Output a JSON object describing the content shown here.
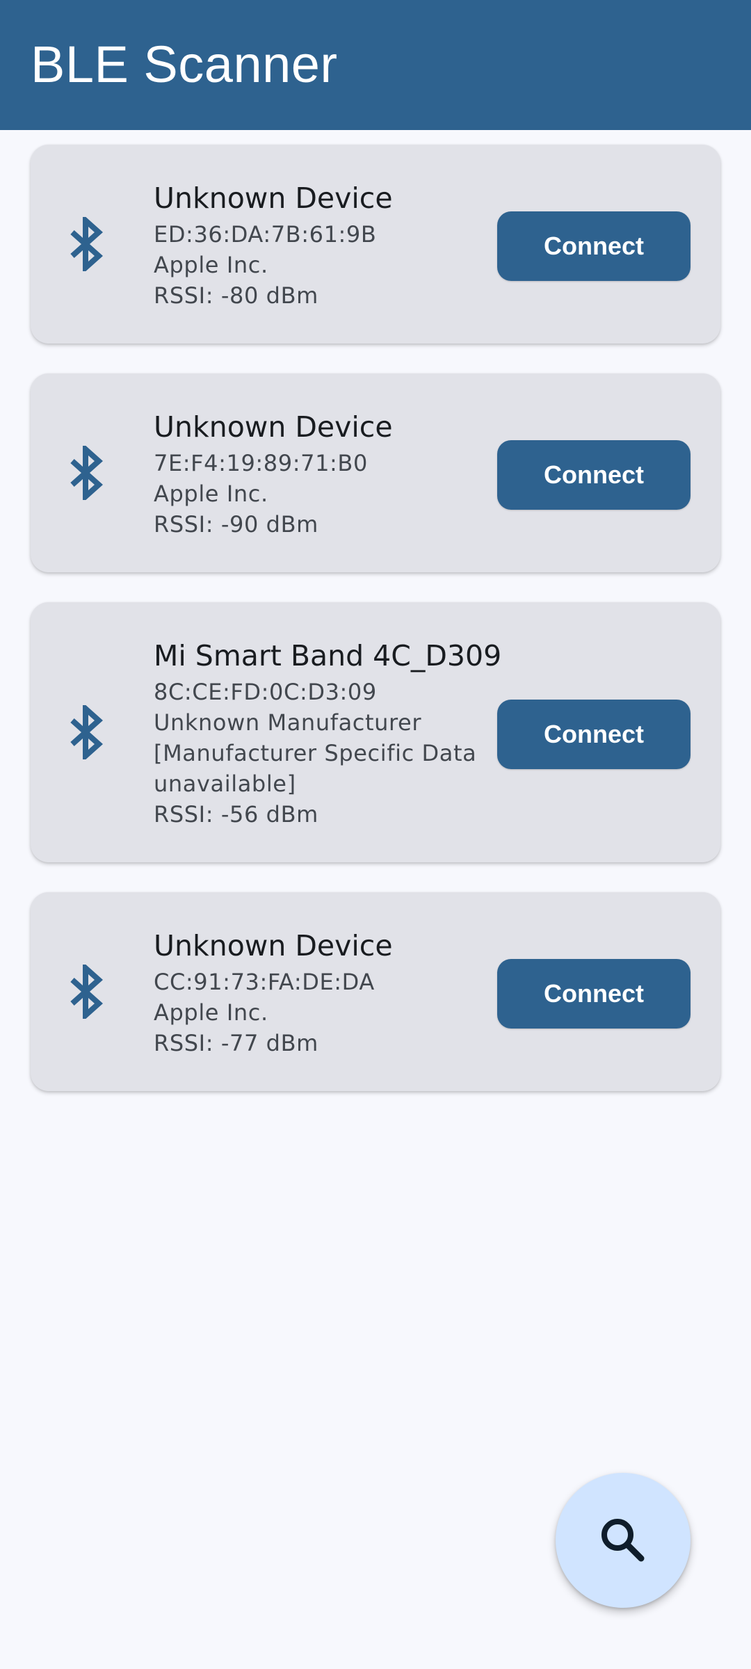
{
  "app_bar": {
    "title": "BLE Scanner",
    "color": "#2e628f"
  },
  "devices": [
    {
      "name": "Unknown Device",
      "address": "ED:36:DA:7B:61:9B",
      "manufacturer": "Apple Inc.",
      "rssi": "RSSI: -80 dBm",
      "icon": "bluetooth-icon",
      "button_label": "Connect"
    },
    {
      "name": "Unknown Device",
      "address": "7E:F4:19:89:71:B0",
      "manufacturer": "Apple Inc.",
      "rssi": "RSSI: -90 dBm",
      "icon": "bluetooth-icon",
      "button_label": "Connect"
    },
    {
      "name": "Mi Smart Band 4C_D309",
      "address": "8C:CE:FD:0C:D3:09",
      "manufacturer": "Unknown Manufacturer",
      "extra": "[Manufacturer Specific Data unavailable]",
      "rssi": "RSSI: -56 dBm",
      "icon": "bluetooth-icon",
      "button_label": "Connect"
    },
    {
      "name": "Unknown Device",
      "address": "CC:91:73:FA:DE:DA",
      "manufacturer": "Apple Inc.",
      "rssi": "RSSI: -77 dBm",
      "icon": "bluetooth-icon",
      "button_label": "Connect"
    }
  ],
  "fab": {
    "icon": "search-icon",
    "color": "#d0e4ff"
  },
  "colors": {
    "card_background": "#e1e2e8",
    "page_background": "#f7f8fd",
    "accent": "#2e628f"
  }
}
